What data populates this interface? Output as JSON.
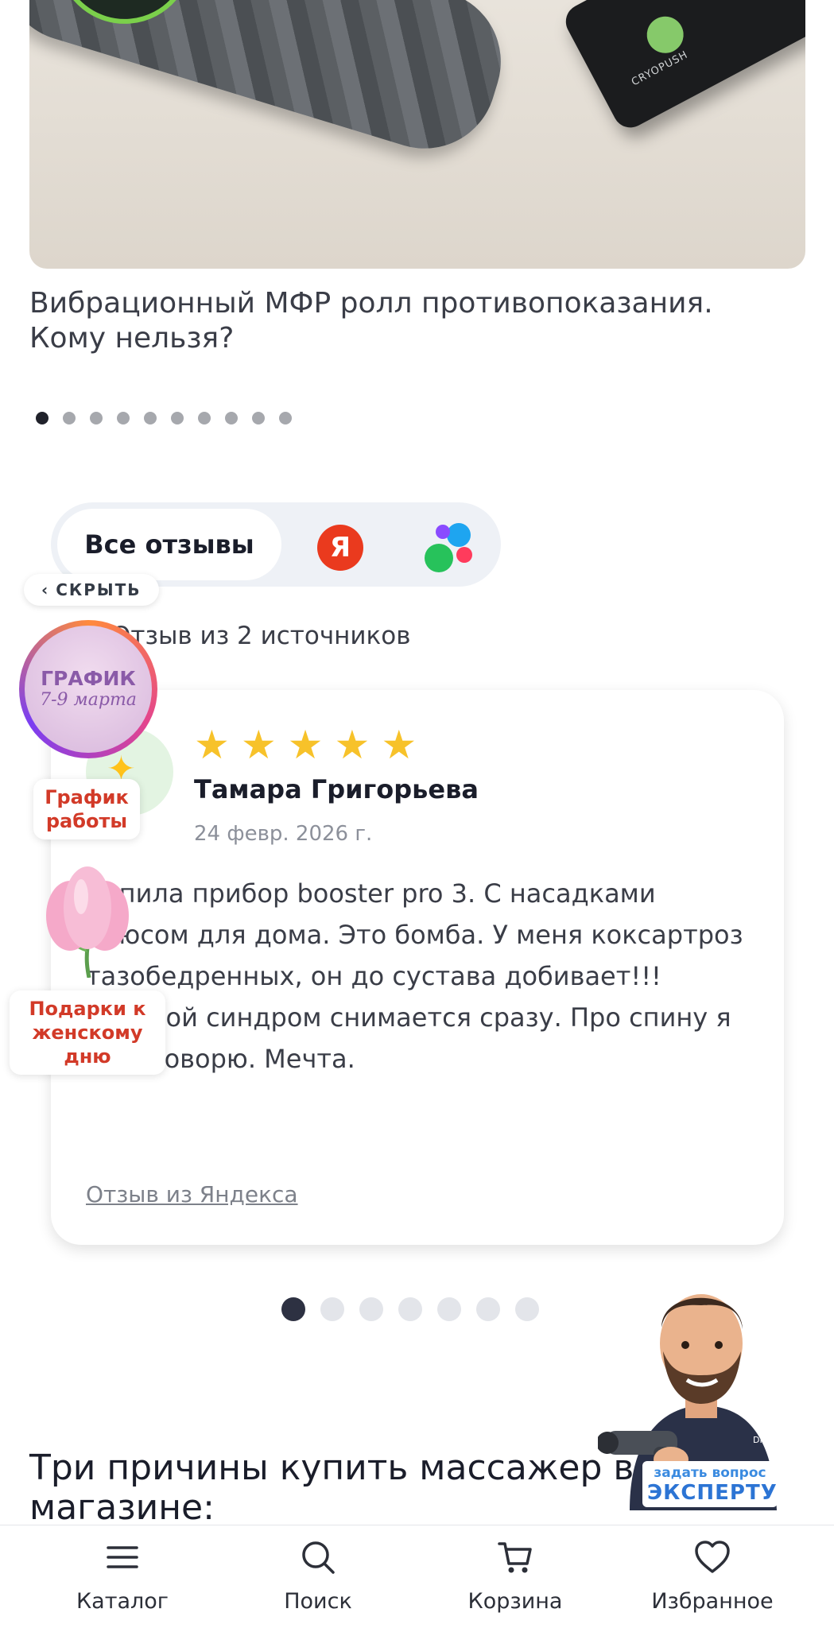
{
  "article": {
    "image_alt_text": "",
    "roller_brand": "CRYOPUSH",
    "title": "Вибрационный МФР ролл противопоказания. Кому нельзя?",
    "pagination_count": 10,
    "pagination_active": 1
  },
  "reviews": {
    "tabs": {
      "all_label": "Все отзывы",
      "yandex_letter": "Я"
    },
    "hide_label": "СКРЫТЬ",
    "sources_caption": "Отзыв из 2 источников",
    "card": {
      "rating": 5,
      "author": "Тамара Григорьева",
      "date": "24 февр. 2026 г.",
      "text": "Купила прибор booster pro 3. С насадками плюсом для дома. Это бомба. У меня коксартроз тазобедренных, он до сустава добивает!!! Болевой синдром снимается сразу. Про спину я и не говорю. Мечта.",
      "source_link": "Отзыв из Яндекса"
    },
    "pagination_count": 7,
    "pagination_active": 1
  },
  "promos": {
    "story": {
      "line1": "ГРАФИК",
      "line2": "7-9 марта"
    },
    "schedule_label": "График работы",
    "gifts_label": "Подарки к женскому дню"
  },
  "reasons": {
    "title": "Три причины купить массажер в магазине:"
  },
  "expert": {
    "line1": "задать вопрос",
    "line2": "ЭКСПЕРТУ"
  },
  "bottom_nav": {
    "catalog": "Каталог",
    "search": "Поиск",
    "cart": "Корзина",
    "favorites": "Избранное"
  },
  "colors": {
    "accent_dark": "#2d3142",
    "star": "#f7c22a",
    "yandex": "#ea3a1e",
    "promo_red": "#d23a28",
    "expert_blue": "#2c74d4"
  }
}
